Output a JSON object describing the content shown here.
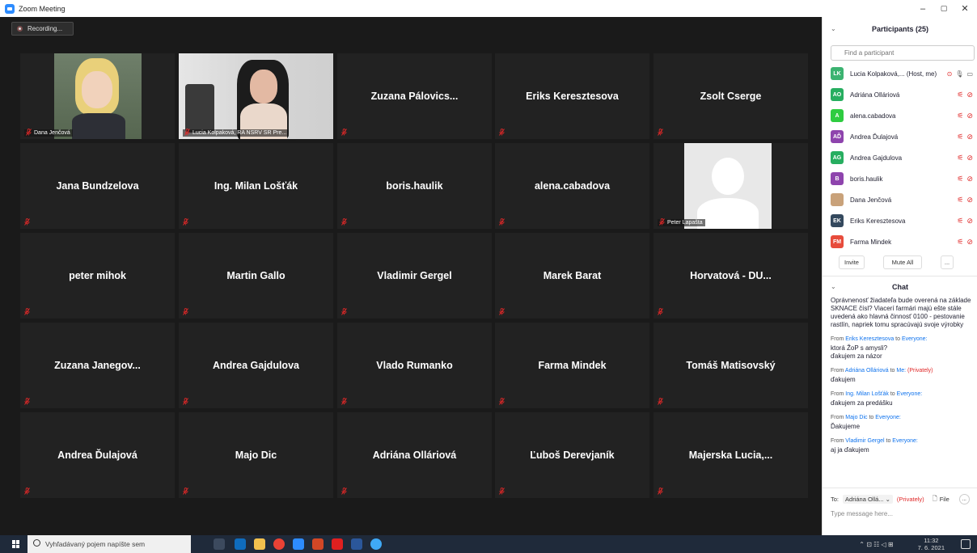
{
  "window": {
    "title": "Zoom Meeting",
    "minimize": "–",
    "restore": "▢",
    "close": "✕"
  },
  "recording": {
    "label": "Recording..."
  },
  "tiles": [
    {
      "name": "Dana Jenčová",
      "type": "photo"
    },
    {
      "name": "Lucia Kolpaková, RA NSRV SR Pre...",
      "type": "video"
    },
    {
      "name": "Zuzana  Pálovics...",
      "type": "name"
    },
    {
      "name": "Eriks Keresztesova",
      "type": "name"
    },
    {
      "name": "Zsolt Cserge",
      "type": "name"
    },
    {
      "name": "Jana Bundzelova",
      "type": "name"
    },
    {
      "name": "Ing. Milan Lošťák",
      "type": "name"
    },
    {
      "name": "boris.haulik",
      "type": "name"
    },
    {
      "name": "alena.cabadova",
      "type": "name"
    },
    {
      "name": "Peter Lapašta",
      "type": "avatar"
    },
    {
      "name": "peter mihok",
      "type": "name"
    },
    {
      "name": "Martin Gallo",
      "type": "name"
    },
    {
      "name": "Vladimir Gergel",
      "type": "name"
    },
    {
      "name": "Marek Barat",
      "type": "name"
    },
    {
      "name": "Horvatová - DU...",
      "type": "name"
    },
    {
      "name": "Zuzana  Janegov...",
      "type": "name"
    },
    {
      "name": "Andrea Gajdulova",
      "type": "name"
    },
    {
      "name": "Vlado Rumanko",
      "type": "name"
    },
    {
      "name": "Farma Mindek",
      "type": "name"
    },
    {
      "name": "Tomáš Matisovský",
      "type": "name"
    },
    {
      "name": "Andrea Ďulajová",
      "type": "name"
    },
    {
      "name": "Majo Dic",
      "type": "name"
    },
    {
      "name": "Adriána Olláriová",
      "type": "name"
    },
    {
      "name": "Ľuboš Derevjaník",
      "type": "name"
    },
    {
      "name": "Majerska Lucia,...",
      "type": "name"
    }
  ],
  "participants": {
    "title": "Participants (25)",
    "search_placeholder": "Find a participant",
    "list": [
      {
        "initials": "LK",
        "name": "Lucia Kolpaková,... (Host, me)",
        "color": "#3cb371"
      },
      {
        "initials": "AO",
        "name": "Adriána Olláriová",
        "color": "#27ae60"
      },
      {
        "initials": "A",
        "name": "alena.cabadova",
        "color": "#2ecc40"
      },
      {
        "initials": "AĎ",
        "name": "Andrea Ďulajová",
        "color": "#8e44ad"
      },
      {
        "initials": "AG",
        "name": "Andrea Gajdulova",
        "color": "#27ae60"
      },
      {
        "initials": "B",
        "name": "boris.haulik",
        "color": "#8e44ad"
      },
      {
        "initials": "",
        "name": "Dana Jenčová",
        "color": "#c9a27a"
      },
      {
        "initials": "EK",
        "name": "Eriks Keresztesova",
        "color": "#34495e"
      },
      {
        "initials": "FM",
        "name": "Farma Mindek",
        "color": "#e74c3c"
      }
    ],
    "invite": "Invite",
    "mute_all": "Mute All",
    "more": "..."
  },
  "chat": {
    "title": "Chat",
    "messages": [
      {
        "text": "Oprávnenosť žiadateľa bude overená na základe SKNACE čísl? Viacerí farmári majú ešte stále uvedená ako hlavná činnosť 0100 - pestovanie rastlín, napriek tomu spracúvajú svoje výrobky"
      },
      {
        "from_prefix": "From",
        "from": "Eriks Keresztesova",
        "to_word": "to",
        "to": "Everyone:",
        "text": "ktorá ŽoP s amysli?\nďakujem za názor"
      },
      {
        "from_prefix": "From",
        "from": "Adriána Olláriová",
        "to_word": "to",
        "to": "Me:",
        "private": "(Privately)",
        "text": "ďakujem"
      },
      {
        "from_prefix": "From",
        "from": "Ing. Milan Lošťák",
        "to_word": "to",
        "to": "Everyone:",
        "text": "ďakujem za predášku"
      },
      {
        "from_prefix": "From",
        "from": "Majo Dic",
        "to_word": "to",
        "to": "Everyone:",
        "text": "Ďakujeme"
      },
      {
        "from_prefix": "From",
        "from": "Vladimir Gergel",
        "to_word": "to",
        "to": "Everyone:",
        "text": "aj ja ďakujem"
      }
    ],
    "to_label": "To:",
    "to_value": "Adriána Ollá...",
    "to_private": "(Privately)",
    "file": "File",
    "more": "...",
    "placeholder": "Type message here..."
  },
  "taskbar": {
    "search": "Vyhľadávaný pojem napíšte sem",
    "time": "11:32",
    "date": "7. 6. 2021"
  }
}
